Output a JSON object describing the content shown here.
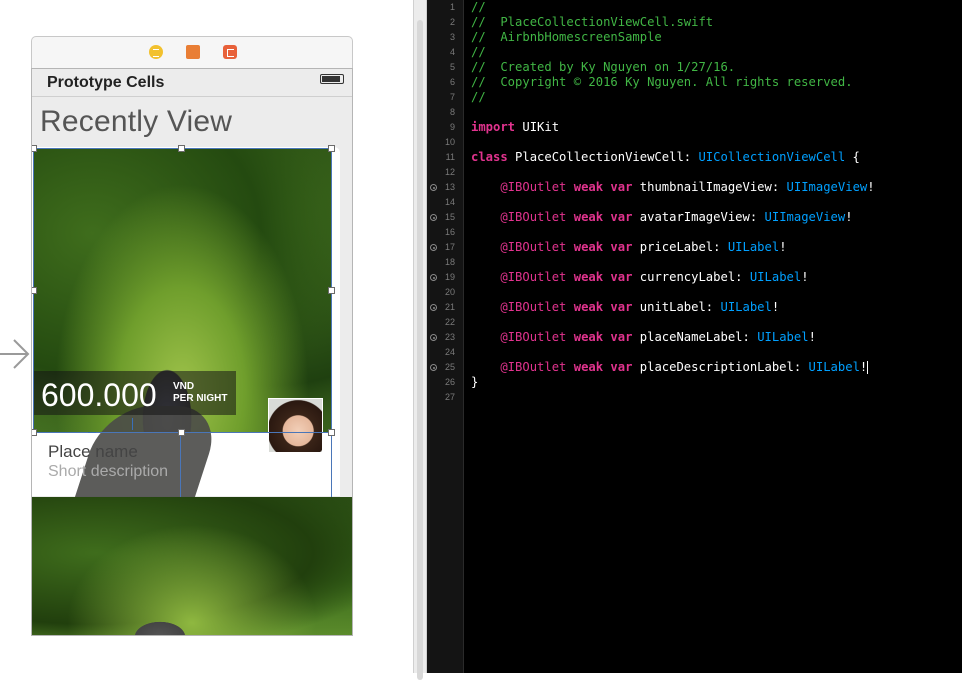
{
  "storyboard": {
    "prototype_cells_label": "Prototype Cells",
    "section_title": "Recently View",
    "cell": {
      "price": "600.000",
      "currency": "VND",
      "unit": "PER NIGHT",
      "place_name": "Place name",
      "description": "Short description"
    }
  },
  "editor": {
    "lines": [
      {
        "n": "1",
        "parts": [
          {
            "t": "//",
            "c": "cmt"
          }
        ]
      },
      {
        "n": "2",
        "parts": [
          {
            "t": "//  PlaceCollectionViewCell.swift",
            "c": "cmt"
          }
        ]
      },
      {
        "n": "3",
        "parts": [
          {
            "t": "//  AirbnbHomescreenSample",
            "c": "cmt"
          }
        ]
      },
      {
        "n": "4",
        "parts": [
          {
            "t": "//",
            "c": "cmt"
          }
        ]
      },
      {
        "n": "5",
        "parts": [
          {
            "t": "//  Created by Ky Nguyen on 1/27/16.",
            "c": "cmt"
          }
        ]
      },
      {
        "n": "6",
        "parts": [
          {
            "t": "//  Copyright © 2016 Ky Nguyen. All rights reserved.",
            "c": "cmt"
          }
        ]
      },
      {
        "n": "7",
        "parts": [
          {
            "t": "//",
            "c": "cmt"
          }
        ]
      },
      {
        "n": "8",
        "parts": []
      },
      {
        "n": "9",
        "parts": [
          {
            "t": "import",
            "c": "kw"
          },
          {
            "t": " UIKit",
            "c": "plain"
          }
        ]
      },
      {
        "n": "10",
        "parts": []
      },
      {
        "n": "11",
        "parts": [
          {
            "t": "class",
            "c": "kw"
          },
          {
            "t": " PlaceCollectionViewCell: ",
            "c": "plain"
          },
          {
            "t": "UICollectionViewCell",
            "c": "typ"
          },
          {
            "t": " {",
            "c": "plain"
          }
        ]
      },
      {
        "n": "12",
        "parts": []
      },
      {
        "n": "13",
        "outlet": true,
        "parts": [
          {
            "t": "    @IBOutlet",
            "c": "attr"
          },
          {
            "t": " weak var",
            "c": "kw"
          },
          {
            "t": " thumbnailImageView: ",
            "c": "plain"
          },
          {
            "t": "UIImageView",
            "c": "typ"
          },
          {
            "t": "!",
            "c": "plain"
          }
        ]
      },
      {
        "n": "14",
        "parts": []
      },
      {
        "n": "15",
        "outlet": true,
        "parts": [
          {
            "t": "    @IBOutlet",
            "c": "attr"
          },
          {
            "t": " weak var",
            "c": "kw"
          },
          {
            "t": " avatarImageView: ",
            "c": "plain"
          },
          {
            "t": "UIImageView",
            "c": "typ"
          },
          {
            "t": "!",
            "c": "plain"
          }
        ]
      },
      {
        "n": "16",
        "parts": []
      },
      {
        "n": "17",
        "outlet": true,
        "parts": [
          {
            "t": "    @IBOutlet",
            "c": "attr"
          },
          {
            "t": " weak var",
            "c": "kw"
          },
          {
            "t": " priceLabel: ",
            "c": "plain"
          },
          {
            "t": "UILabel",
            "c": "typ"
          },
          {
            "t": "!",
            "c": "plain"
          }
        ]
      },
      {
        "n": "18",
        "parts": []
      },
      {
        "n": "19",
        "outlet": true,
        "parts": [
          {
            "t": "    @IBOutlet",
            "c": "attr"
          },
          {
            "t": " weak var",
            "c": "kw"
          },
          {
            "t": " currencyLabel: ",
            "c": "plain"
          },
          {
            "t": "UILabel",
            "c": "typ"
          },
          {
            "t": "!",
            "c": "plain"
          }
        ]
      },
      {
        "n": "20",
        "parts": []
      },
      {
        "n": "21",
        "outlet": true,
        "parts": [
          {
            "t": "    @IBOutlet",
            "c": "attr"
          },
          {
            "t": " weak var",
            "c": "kw"
          },
          {
            "t": " unitLabel: ",
            "c": "plain"
          },
          {
            "t": "UILabel",
            "c": "typ"
          },
          {
            "t": "!",
            "c": "plain"
          }
        ]
      },
      {
        "n": "22",
        "parts": []
      },
      {
        "n": "23",
        "outlet": true,
        "parts": [
          {
            "t": "    @IBOutlet",
            "c": "attr"
          },
          {
            "t": " weak var",
            "c": "kw"
          },
          {
            "t": " placeNameLabel: ",
            "c": "plain"
          },
          {
            "t": "UILabel",
            "c": "typ"
          },
          {
            "t": "!",
            "c": "plain"
          }
        ]
      },
      {
        "n": "24",
        "parts": []
      },
      {
        "n": "25",
        "outlet": true,
        "cursor": true,
        "parts": [
          {
            "t": "    @IBOutlet",
            "c": "attr"
          },
          {
            "t": " weak var",
            "c": "kw"
          },
          {
            "t": " placeDescriptionLabel: ",
            "c": "plain"
          },
          {
            "t": "UILabel",
            "c": "typ"
          },
          {
            "t": "!",
            "c": "plain"
          }
        ]
      },
      {
        "n": "26",
        "parts": [
          {
            "t": "}",
            "c": "plain"
          }
        ]
      },
      {
        "n": "27",
        "parts": []
      }
    ]
  },
  "colors": {
    "comment": "#41b645",
    "keyword": "#e1338e",
    "type": "#00a0ff",
    "editor_background": "#000000"
  }
}
